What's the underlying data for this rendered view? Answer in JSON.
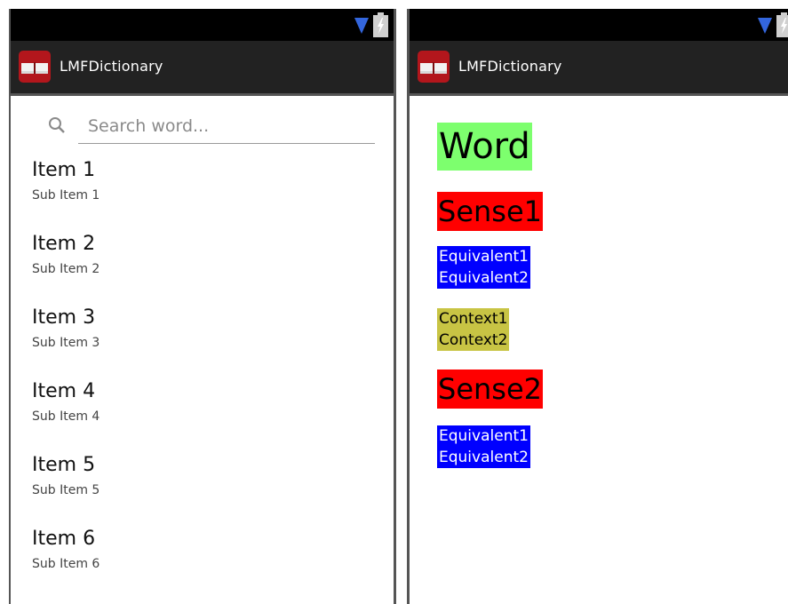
{
  "app": {
    "title": "LMFDictionary"
  },
  "icons": {
    "wifi": "wifi-signal-icon",
    "battery": "battery-charging-icon",
    "app": "book-icon",
    "search": "search-icon"
  },
  "colors": {
    "status_bar": "#000000",
    "action_bar": "#222222",
    "wifi": "#3366dd",
    "word_highlight": "#7dff6e",
    "sense_highlight": "#ff0000",
    "equivalent_highlight": "#0000ff",
    "context_highlight": "#c8c444"
  },
  "left_screen": {
    "search": {
      "placeholder": "Search word...",
      "value": ""
    },
    "items": [
      {
        "title": "Item 1",
        "subtitle": "Sub Item 1"
      },
      {
        "title": "Item 2",
        "subtitle": "Sub Item 2"
      },
      {
        "title": "Item 3",
        "subtitle": "Sub Item 3"
      },
      {
        "title": "Item 4",
        "subtitle": "Sub Item 4"
      },
      {
        "title": "Item 5",
        "subtitle": "Sub Item 5"
      },
      {
        "title": "Item 6",
        "subtitle": "Sub Item 6"
      }
    ]
  },
  "right_screen": {
    "word": "Word",
    "senses": [
      {
        "label": "Sense1",
        "equivalents": [
          "Equivalent1",
          "Equivalent2"
        ],
        "contexts": [
          "Context1",
          "Context2"
        ]
      },
      {
        "label": "Sense2",
        "equivalents": [
          "Equivalent1",
          "Equivalent2"
        ],
        "contexts": []
      }
    ]
  }
}
